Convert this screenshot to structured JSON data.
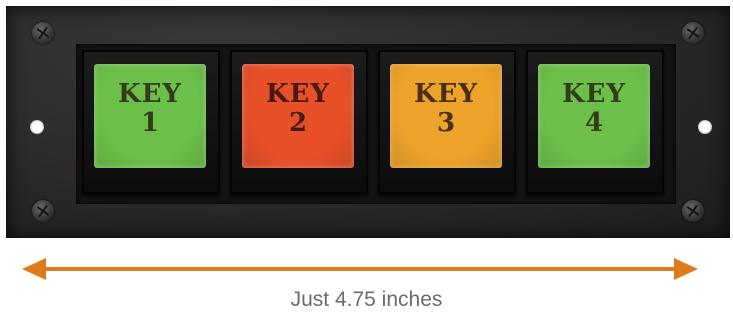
{
  "keys": [
    {
      "line1": "KEY",
      "line2": "1",
      "color": "#6cc04a",
      "text_color": "#333d1c"
    },
    {
      "line1": "KEY",
      "line2": "2",
      "color": "#e8502a",
      "text_color": "#4a1a10"
    },
    {
      "line1": "KEY",
      "line2": "3",
      "color": "#eda22a",
      "text_color": "#4a3010"
    },
    {
      "line1": "KEY",
      "line2": "4",
      "color": "#6cc04a",
      "text_color": "#333d1c"
    }
  ],
  "dimension_arrow": {
    "color": "#e07a1f"
  },
  "caption": "Just 4.75 inches"
}
